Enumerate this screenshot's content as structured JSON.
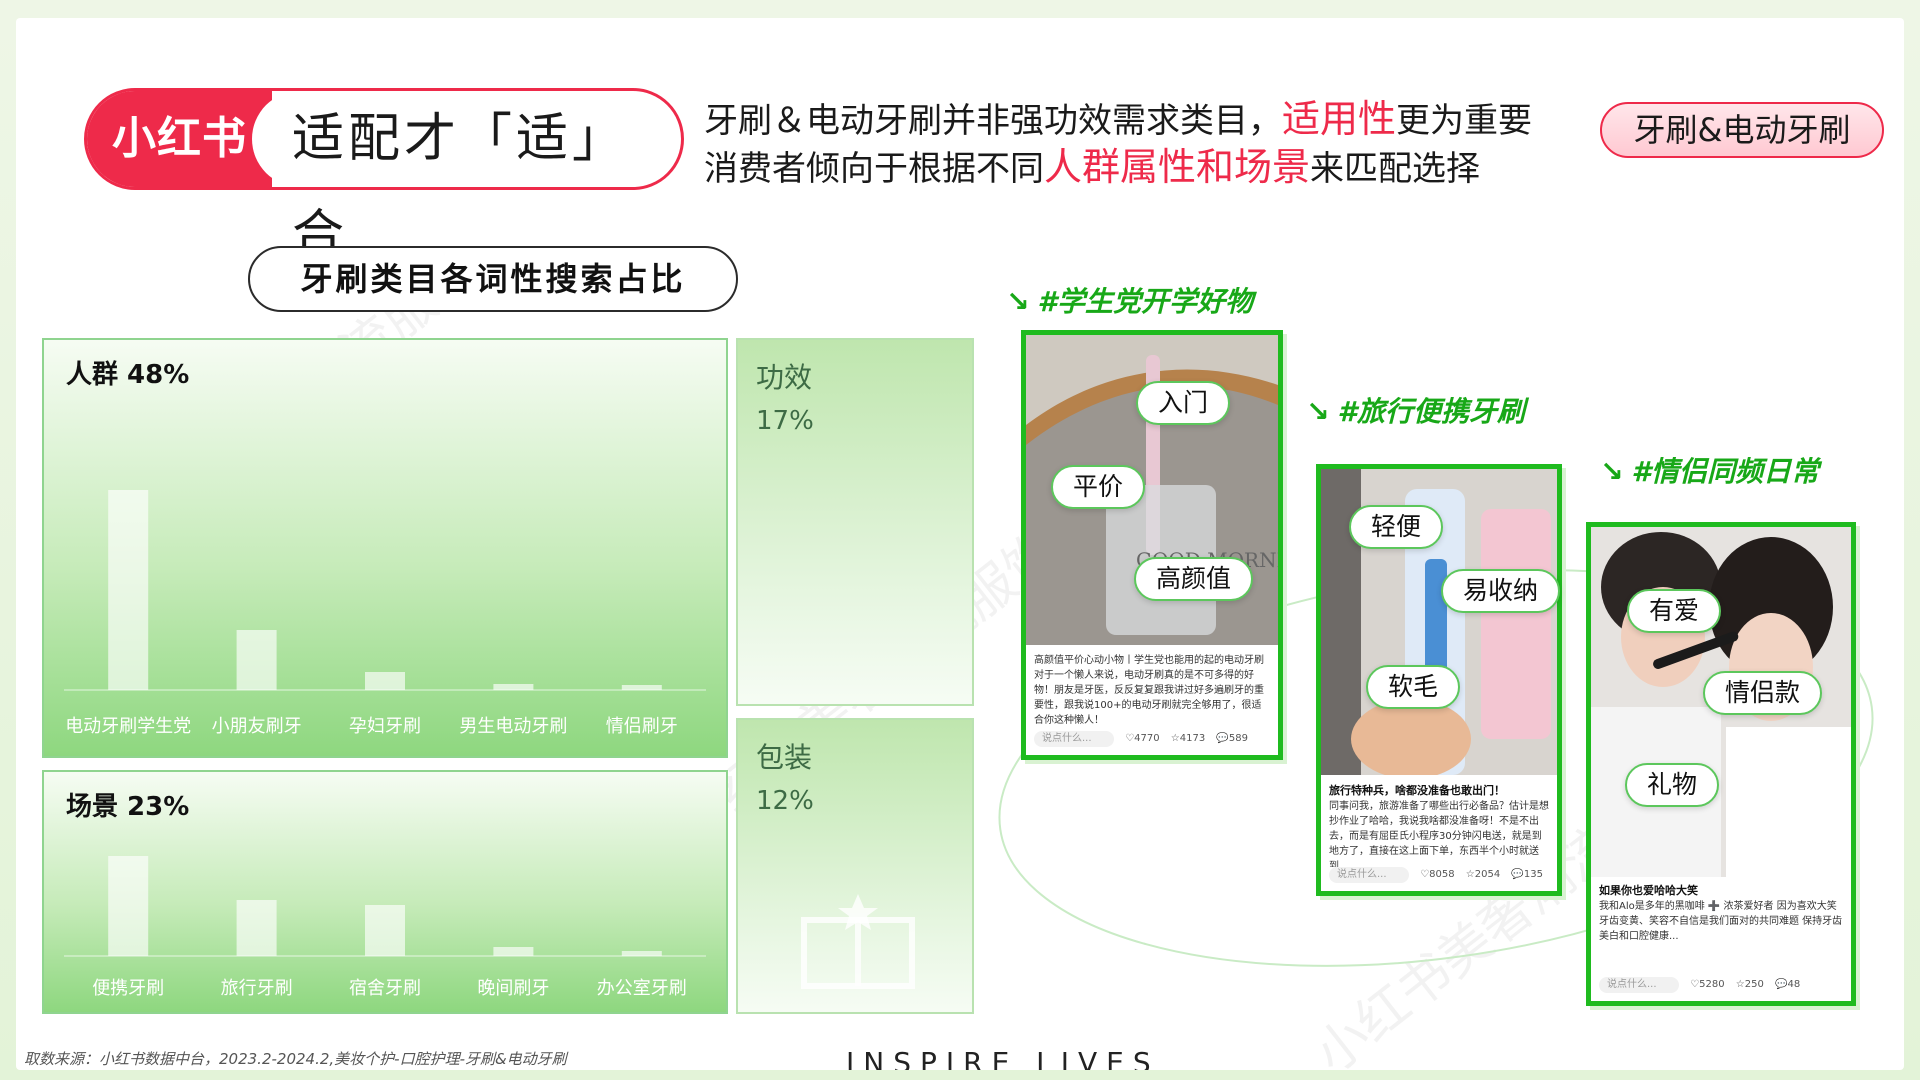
{
  "header": {
    "brand_logo": "小红书",
    "brand_title": "适配才「适」合",
    "headline_line1_a": "牙刷＆电动牙刷并非强功效需求类目，",
    "headline_line1_hl": "适用性",
    "headline_line1_b": "更为重要",
    "headline_line2_a": "消费者倾向于根据不同",
    "headline_line2_hl": "人群属性和场景",
    "headline_line2_b": "来匹配选择",
    "category_tag": "牙刷&电动牙刷"
  },
  "colors": {
    "brand_red": "#ee2a4a",
    "green": "#1fbb1f"
  },
  "chart_title": "牙刷类目各词性搜索占比",
  "chart_data": [
    {
      "type": "bar",
      "title": "人群 48%",
      "categories": [
        "电动牙刷学生党",
        "小朋友刷牙",
        "孕妇牙刷",
        "男生电动牙刷",
        "情侣刷牙"
      ],
      "values": [
        100,
        30,
        9,
        3,
        2.5
      ],
      "ylim": [
        0,
        100
      ],
      "grid": false
    },
    {
      "type": "bar",
      "title": "场景 23%",
      "categories": [
        "便携牙刷",
        "旅行牙刷",
        "宿舍牙刷",
        "晚间刷牙",
        "办公室牙刷"
      ],
      "values": [
        100,
        56,
        51,
        9,
        5
      ],
      "ylim": [
        0,
        100
      ],
      "grid": false
    }
  ],
  "side_panels": [
    {
      "name": "功效",
      "value": "17%"
    },
    {
      "name": "包装",
      "value": "12%"
    }
  ],
  "cards": [
    {
      "hashtag": "#学生党开学好物",
      "tags": [
        "入门",
        "平价",
        "高颜值"
      ],
      "photo_text": "GOOD MORNING",
      "caption": "高颜值平价心动小物丨学生党也能用的起的电动牙刷 对于一个懒人来说，电动牙刷真的是不可多得的好物！朋友是牙医，反反复复跟我讲过好多遍刷牙的重要性，跟我说100+的电动牙刷就完全够用了，很适合你这种懒人！",
      "reply_placeholder": "说点什么...",
      "likes": "4770",
      "stars": "4173",
      "comments": "589"
    },
    {
      "hashtag": "#旅行便携牙刷",
      "tags": [
        "轻便",
        "易收纳",
        "软毛"
      ],
      "caption_title": "旅行特种兵，啥都没准备也敢出门！",
      "caption": "同事问我，旅游准备了哪些出行必备品？估计是想抄作业了哈哈，我说我啥都没准备呀！不是不出去，而是有屈臣氏小程序30分钟闪电送，就是到地方了，直接在这上面下单，东西半个小时就送到...",
      "reply_placeholder": "说点什么...",
      "likes": "8058",
      "stars": "2054",
      "comments": "135"
    },
    {
      "hashtag": "#情侣同频日常",
      "tags": [
        "有爱",
        "情侣款",
        "礼物"
      ],
      "caption_title": "如果你也爱哈哈大笑",
      "caption": "我和Alo是多年的黑咖啡 ➕ 浓茶爱好者 因为喜欢大笑 牙齿变黄、笑容不自信是我们面对的共同难题 保持牙齿美白和口腔健康...",
      "reply_placeholder": "说点什么...",
      "likes": "5280",
      "stars": "250",
      "comments": "48"
    }
  ],
  "source": "取数来源：小红书数据中台，2023.2-2024.2,美妆个护-口腔护理-牙刷&电动牙刷",
  "slogan": "INSPIRE  LIVES",
  "watermark": "小红书美奢潮流服饰"
}
